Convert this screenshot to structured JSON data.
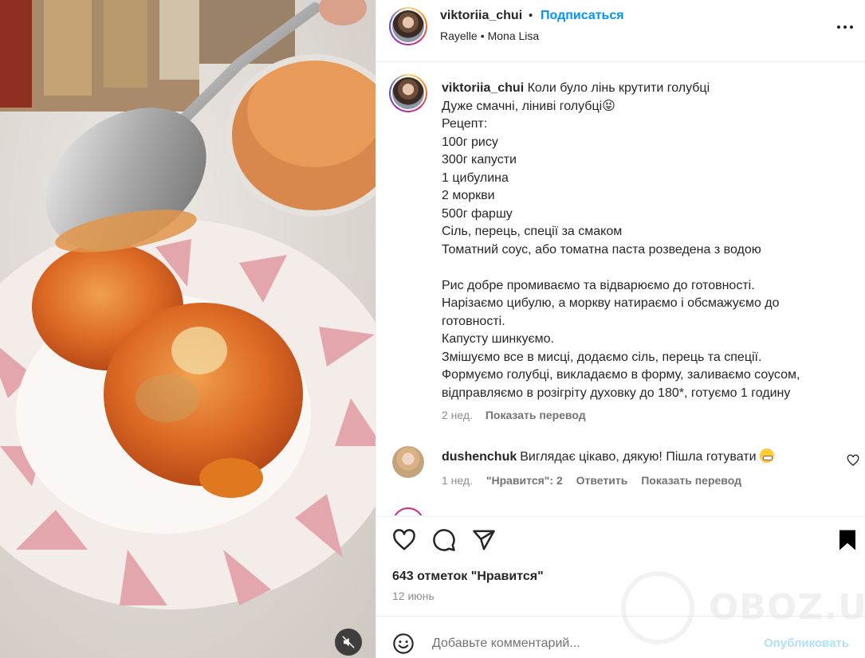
{
  "header": {
    "username": "viktoriia_chui",
    "dot": "•",
    "follow_label": "Подписаться",
    "audio": {
      "artist": "Rayelle",
      "separator": "•",
      "track": "Mona Lisa"
    }
  },
  "caption": {
    "username": "viktoriia_chui",
    "lines": [
      "Коли було лінь крутити голубці",
      "Дуже смачні, ліниві голубці😝",
      "Рецепт:",
      "100г рису",
      "300г капусти",
      "1 цибулина",
      "2 моркви",
      "500г фаршу",
      "Сіль, перець, спеції за смаком",
      "Томатний соус, або томатна паста розведена з водою",
      "",
      "Рис добре промиваємо та відварюємо до готовності.",
      "Нарізаємо цибулю, а моркву натираємо і обсмажуємо до",
      "готовності.",
      "Капусту шинкуємо.",
      "Змішуємо все в мисці, додаємо сіль, перець та спеції.",
      "Формуємо голубці, викладаємо в форму, заливаємо соусом,",
      "відправляємо в розігріту духовку до 180*, готуємо 1 годину"
    ],
    "time": "2 нед.",
    "translate_label": "Показать перевод"
  },
  "comment": {
    "username": "dushenchuk",
    "text": "Виглядає цікаво, дякую! Пішла готувати",
    "time": "1 нед.",
    "likes": "\"Нравится\": 2",
    "reply_label": "Ответить",
    "translate_label": "Показать перевод"
  },
  "actions": {
    "likes_text": "643 отметок \"Нравится\"",
    "date": "12 июнь"
  },
  "add_comment": {
    "placeholder": "Добавьте комментарий...",
    "publish_label": "Опубликовать"
  },
  "watermark": {
    "text": "OBOZ.UA"
  },
  "colors": {
    "follow": "#0095f6",
    "publish_disabled": "#b2dffc",
    "text": "#262626",
    "meta": "#8e8e8e"
  }
}
